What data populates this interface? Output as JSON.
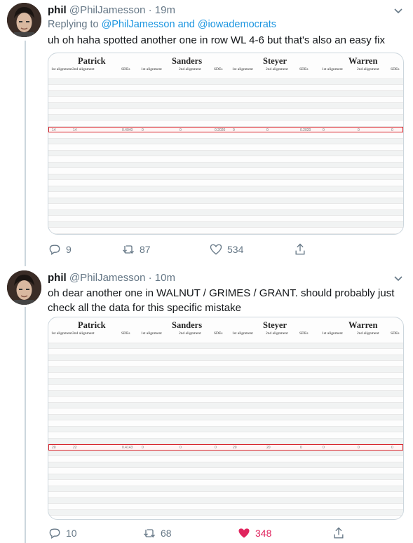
{
  "tweets": [
    {
      "name": "phil",
      "handle": "@PhilJamesson",
      "time": "19m",
      "replying_prefix": "Replying to",
      "replying_mention1": "@PhilJamesson",
      "replying_and": "and",
      "replying_mention2": "@iowademocrats",
      "text": "uh oh haha spotted another one in row WL 4-6 but that's also an easy fix",
      "sheet": {
        "candidates": [
          "Patrick",
          "Sanders",
          "Steyer",
          "Warren"
        ],
        "subheaders": [
          "1st alignment",
          "2nd alignment",
          "SDEs",
          "1st alignment",
          "2nd alignment",
          "SDEs",
          "1st alignment",
          "2nd alignment",
          "SDEs",
          "1st alignment",
          "2nd alignment",
          "SDEs"
        ],
        "highlight_row": [
          "14",
          "14",
          "0.4040",
          "0",
          "0",
          "0.2020",
          "0",
          "0",
          "0.2020",
          "0",
          "0",
          "0"
        ]
      },
      "reply_count": "9",
      "retweet_count": "87",
      "like_count": "534",
      "liked": false
    },
    {
      "name": "phil",
      "handle": "@PhilJamesson",
      "time": "10m",
      "text": "oh dear another one in WALNUT / GRIMES / GRANT. should probably just check all the data for this specific mistake",
      "sheet": {
        "candidates": [
          "Patrick",
          "Sanders",
          "Steyer",
          "Warren"
        ],
        "subheaders": [
          "1st alignment",
          "2nd alignment",
          "SDEs",
          "1st alignment",
          "2nd alignment",
          "SDEs",
          "1st alignment",
          "2nd alignment",
          "SDEs",
          "1st alignment",
          "2nd alignment",
          "SDEs"
        ],
        "highlight_row": [
          "20",
          "22",
          "0.4143",
          "0",
          "0",
          "0",
          "20",
          "20",
          "0",
          "0",
          "0",
          "0"
        ]
      },
      "reply_count": "10",
      "retweet_count": "68",
      "like_count": "348",
      "liked": true
    }
  ],
  "colors": {
    "accent": "#1b95e0",
    "muted": "#657786",
    "like": "#e0245e",
    "highlight": "#d9232a"
  },
  "icons": [
    "reply-icon",
    "retweet-icon",
    "like-icon",
    "share-icon",
    "caret-down-icon"
  ]
}
